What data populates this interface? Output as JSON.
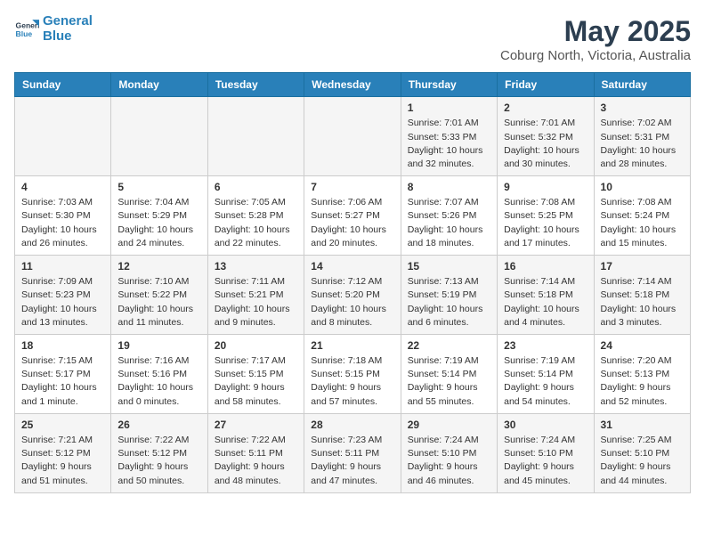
{
  "header": {
    "logo_line1": "General",
    "logo_line2": "Blue",
    "title": "May 2025",
    "subtitle": "Coburg North, Victoria, Australia"
  },
  "days_of_week": [
    "Sunday",
    "Monday",
    "Tuesday",
    "Wednesday",
    "Thursday",
    "Friday",
    "Saturday"
  ],
  "weeks": [
    [
      {
        "day": "",
        "info": ""
      },
      {
        "day": "",
        "info": ""
      },
      {
        "day": "",
        "info": ""
      },
      {
        "day": "",
        "info": ""
      },
      {
        "day": "1",
        "info": "Sunrise: 7:01 AM\nSunset: 5:33 PM\nDaylight: 10 hours\nand 32 minutes."
      },
      {
        "day": "2",
        "info": "Sunrise: 7:01 AM\nSunset: 5:32 PM\nDaylight: 10 hours\nand 30 minutes."
      },
      {
        "day": "3",
        "info": "Sunrise: 7:02 AM\nSunset: 5:31 PM\nDaylight: 10 hours\nand 28 minutes."
      }
    ],
    [
      {
        "day": "4",
        "info": "Sunrise: 7:03 AM\nSunset: 5:30 PM\nDaylight: 10 hours\nand 26 minutes."
      },
      {
        "day": "5",
        "info": "Sunrise: 7:04 AM\nSunset: 5:29 PM\nDaylight: 10 hours\nand 24 minutes."
      },
      {
        "day": "6",
        "info": "Sunrise: 7:05 AM\nSunset: 5:28 PM\nDaylight: 10 hours\nand 22 minutes."
      },
      {
        "day": "7",
        "info": "Sunrise: 7:06 AM\nSunset: 5:27 PM\nDaylight: 10 hours\nand 20 minutes."
      },
      {
        "day": "8",
        "info": "Sunrise: 7:07 AM\nSunset: 5:26 PM\nDaylight: 10 hours\nand 18 minutes."
      },
      {
        "day": "9",
        "info": "Sunrise: 7:08 AM\nSunset: 5:25 PM\nDaylight: 10 hours\nand 17 minutes."
      },
      {
        "day": "10",
        "info": "Sunrise: 7:08 AM\nSunset: 5:24 PM\nDaylight: 10 hours\nand 15 minutes."
      }
    ],
    [
      {
        "day": "11",
        "info": "Sunrise: 7:09 AM\nSunset: 5:23 PM\nDaylight: 10 hours\nand 13 minutes."
      },
      {
        "day": "12",
        "info": "Sunrise: 7:10 AM\nSunset: 5:22 PM\nDaylight: 10 hours\nand 11 minutes."
      },
      {
        "day": "13",
        "info": "Sunrise: 7:11 AM\nSunset: 5:21 PM\nDaylight: 10 hours\nand 9 minutes."
      },
      {
        "day": "14",
        "info": "Sunrise: 7:12 AM\nSunset: 5:20 PM\nDaylight: 10 hours\nand 8 minutes."
      },
      {
        "day": "15",
        "info": "Sunrise: 7:13 AM\nSunset: 5:19 PM\nDaylight: 10 hours\nand 6 minutes."
      },
      {
        "day": "16",
        "info": "Sunrise: 7:14 AM\nSunset: 5:18 PM\nDaylight: 10 hours\nand 4 minutes."
      },
      {
        "day": "17",
        "info": "Sunrise: 7:14 AM\nSunset: 5:18 PM\nDaylight: 10 hours\nand 3 minutes."
      }
    ],
    [
      {
        "day": "18",
        "info": "Sunrise: 7:15 AM\nSunset: 5:17 PM\nDaylight: 10 hours\nand 1 minute."
      },
      {
        "day": "19",
        "info": "Sunrise: 7:16 AM\nSunset: 5:16 PM\nDaylight: 10 hours\nand 0 minutes."
      },
      {
        "day": "20",
        "info": "Sunrise: 7:17 AM\nSunset: 5:15 PM\nDaylight: 9 hours\nand 58 minutes."
      },
      {
        "day": "21",
        "info": "Sunrise: 7:18 AM\nSunset: 5:15 PM\nDaylight: 9 hours\nand 57 minutes."
      },
      {
        "day": "22",
        "info": "Sunrise: 7:19 AM\nSunset: 5:14 PM\nDaylight: 9 hours\nand 55 minutes."
      },
      {
        "day": "23",
        "info": "Sunrise: 7:19 AM\nSunset: 5:14 PM\nDaylight: 9 hours\nand 54 minutes."
      },
      {
        "day": "24",
        "info": "Sunrise: 7:20 AM\nSunset: 5:13 PM\nDaylight: 9 hours\nand 52 minutes."
      }
    ],
    [
      {
        "day": "25",
        "info": "Sunrise: 7:21 AM\nSunset: 5:12 PM\nDaylight: 9 hours\nand 51 minutes."
      },
      {
        "day": "26",
        "info": "Sunrise: 7:22 AM\nSunset: 5:12 PM\nDaylight: 9 hours\nand 50 minutes."
      },
      {
        "day": "27",
        "info": "Sunrise: 7:22 AM\nSunset: 5:11 PM\nDaylight: 9 hours\nand 48 minutes."
      },
      {
        "day": "28",
        "info": "Sunrise: 7:23 AM\nSunset: 5:11 PM\nDaylight: 9 hours\nand 47 minutes."
      },
      {
        "day": "29",
        "info": "Sunrise: 7:24 AM\nSunset: 5:10 PM\nDaylight: 9 hours\nand 46 minutes."
      },
      {
        "day": "30",
        "info": "Sunrise: 7:24 AM\nSunset: 5:10 PM\nDaylight: 9 hours\nand 45 minutes."
      },
      {
        "day": "31",
        "info": "Sunrise: 7:25 AM\nSunset: 5:10 PM\nDaylight: 9 hours\nand 44 minutes."
      }
    ]
  ]
}
